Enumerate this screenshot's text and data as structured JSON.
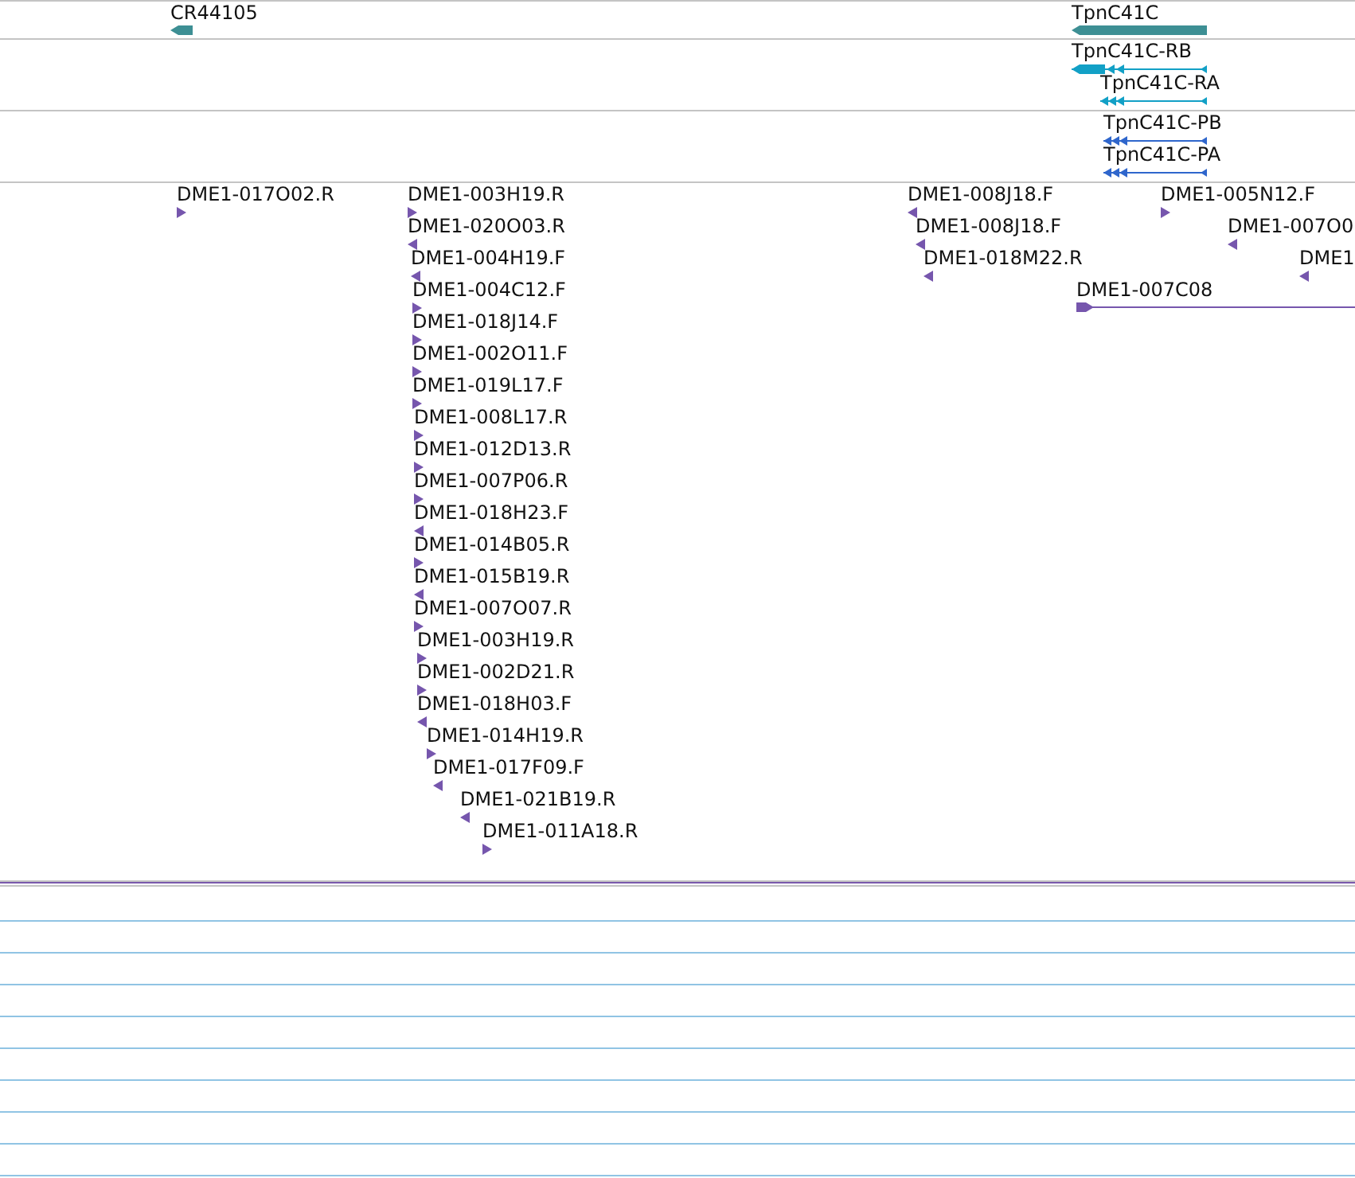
{
  "tracks": [
    {
      "kind": "gene",
      "features": [
        {
          "label": "CR44105",
          "reverse": true
        },
        {
          "label": "TpnC41C",
          "reverse": true
        }
      ]
    },
    {
      "kind": "rna",
      "features": [
        {
          "label": "TpnC41C-RB",
          "reverse": true
        },
        {
          "label": "TpnC41C-RA",
          "reverse": true
        }
      ]
    },
    {
      "kind": "protein",
      "features": [
        {
          "label": "TpnC41C-PB",
          "reverse": true
        },
        {
          "label": "TpnC41C-PA",
          "reverse": true
        }
      ]
    },
    {
      "kind": "clone_end",
      "features": [
        {
          "label": "DME1-017O02.R",
          "reverse": false
        },
        {
          "label": "DME1-003H19.R",
          "reverse": false
        },
        {
          "label": "DME1-020O03.R",
          "reverse": true
        },
        {
          "label": "DME1-004H19.F",
          "reverse": true
        },
        {
          "label": "DME1-004C12.F",
          "reverse": false
        },
        {
          "label": "DME1-018J14.F",
          "reverse": false
        },
        {
          "label": "DME1-002O11.F",
          "reverse": false
        },
        {
          "label": "DME1-019L17.F",
          "reverse": false
        },
        {
          "label": "DME1-008L17.R",
          "reverse": false
        },
        {
          "label": "DME1-012D13.R",
          "reverse": false
        },
        {
          "label": "DME1-007P06.R",
          "reverse": false
        },
        {
          "label": "DME1-018H23.F",
          "reverse": true
        },
        {
          "label": "DME1-014B05.R",
          "reverse": false
        },
        {
          "label": "DME1-015B19.R",
          "reverse": true
        },
        {
          "label": "DME1-007O07.R",
          "reverse": false
        },
        {
          "label": "DME1-003H19.R",
          "reverse": false
        },
        {
          "label": "DME1-002D21.R",
          "reverse": false
        },
        {
          "label": "DME1-018H03.F",
          "reverse": true
        },
        {
          "label": "DME1-014H19.R",
          "reverse": false
        },
        {
          "label": "DME1-017F09.F",
          "reverse": true
        },
        {
          "label": "DME1-021B19.R",
          "reverse": true
        },
        {
          "label": "DME1-011A18.R",
          "reverse": false
        },
        {
          "label": "DME1-008J18.F",
          "reverse": true
        },
        {
          "label": "DME1-008J18.F",
          "reverse": true
        },
        {
          "label": "DME1-018M22.R",
          "reverse": true
        },
        {
          "label": "DME1-005N12.F",
          "reverse": false
        },
        {
          "label": "DME1-007O0",
          "reverse": true
        },
        {
          "label": "DME1",
          "reverse": true
        },
        {
          "label": "DME1-007C08",
          "reverse": false,
          "kind": "clone"
        }
      ]
    }
  ]
}
